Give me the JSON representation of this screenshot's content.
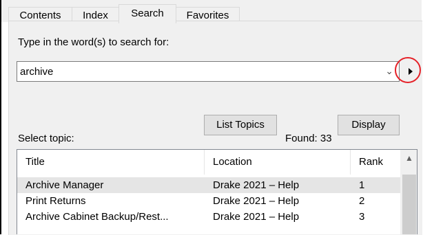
{
  "tabs": [
    {
      "label": "Contents"
    },
    {
      "label": "Index"
    },
    {
      "label": "Search"
    },
    {
      "label": "Favorites"
    }
  ],
  "search": {
    "prompt": "Type in the word(s) to search for:",
    "query": "archive",
    "list_topics_label": "List Topics",
    "display_label": "Display"
  },
  "results": {
    "select_label": "Select topic:",
    "found_label": "Found: 33",
    "columns": [
      "Title",
      "Location",
      "Rank"
    ],
    "rows": [
      {
        "title": "Archive Manager",
        "location": "Drake 2021 – Help",
        "rank": "1"
      },
      {
        "title": "Print Returns",
        "location": "Drake 2021 – Help",
        "rank": "2"
      },
      {
        "title": "Archive Cabinet Backup/Rest...",
        "location": "Drake 2021 – Help",
        "rank": "3"
      }
    ]
  },
  "colors": {
    "highlight_ring": "#e52027",
    "selected_row": "#e5e5e5",
    "panel_bg": "#f0f0f0"
  }
}
